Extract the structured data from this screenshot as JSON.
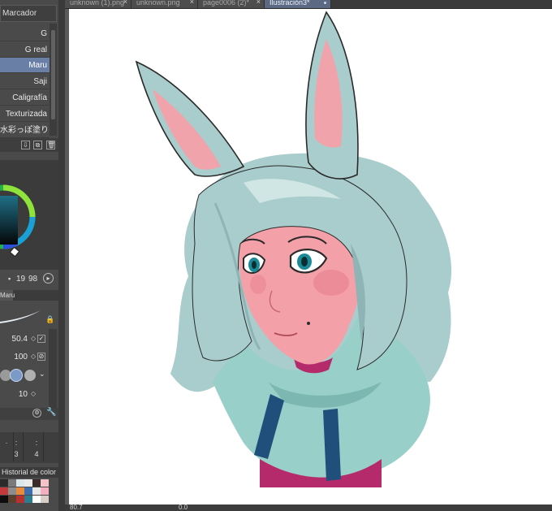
{
  "tabs": [
    {
      "label": "unknown (1).png",
      "active": false,
      "close": "×"
    },
    {
      "label": "unknown.png",
      "active": false,
      "close": "×"
    },
    {
      "label": "page0006 (2)*",
      "active": false,
      "close": "×"
    },
    {
      "label": "Ilustración3*",
      "active": true,
      "close": ""
    }
  ],
  "sidebar": {
    "brush_set": "Marcador",
    "brushes": [
      {
        "label": "G",
        "selected": false
      },
      {
        "label": "G real",
        "selected": false
      },
      {
        "label": "Maru",
        "selected": true
      },
      {
        "label": "Saji",
        "selected": false
      },
      {
        "label": "Caligrafía",
        "selected": false
      },
      {
        "label": "Texturizada",
        "selected": false
      },
      {
        "label": "水彩っぽ塗り",
        "selected": false
      }
    ],
    "color_values": {
      "a": "19",
      "b": "98"
    },
    "subtool_tab": "Maru",
    "brush_size": "50.4",
    "opacity": "100",
    "stabilization": "10",
    "pages": [
      {
        "dots": "·",
        "num": ""
      },
      {
        "dots": ":",
        "num": "3"
      },
      {
        "dots": ":",
        "num": "4"
      }
    ],
    "history_title": "Historial de color",
    "swatches": [
      "#2b2b2b",
      "#7a7a7a",
      "#d9e6ea",
      "#eaeaea",
      "#3b2a2a",
      "#f2c4c8",
      "#c23a3a",
      "#8d8d8d",
      "#e88a3a",
      "#3d6fb0",
      "#e7e7e7",
      "#f3b0c0",
      "#0d0d0d",
      "#5a4030",
      "#b93030",
      "#2e7d8e",
      "#ffffff",
      "#d8d0c8"
    ]
  },
  "canvas": {
    "zoom": "80.7",
    "angle": "0.0"
  },
  "colors": {
    "hair": "#a9cdcc",
    "hair_light": "#cfe6e4",
    "hair_shadow": "#8fb4b6",
    "skin": "#f3a0a8",
    "ear_inner": "#f0a3aa",
    "scarf": "#98cfc9",
    "scarf_shadow": "#7db7b2",
    "strap": "#1f4f7a",
    "shirt": "#b52a6a",
    "eye": "#1b8a96",
    "line": "#2a2a2a"
  }
}
